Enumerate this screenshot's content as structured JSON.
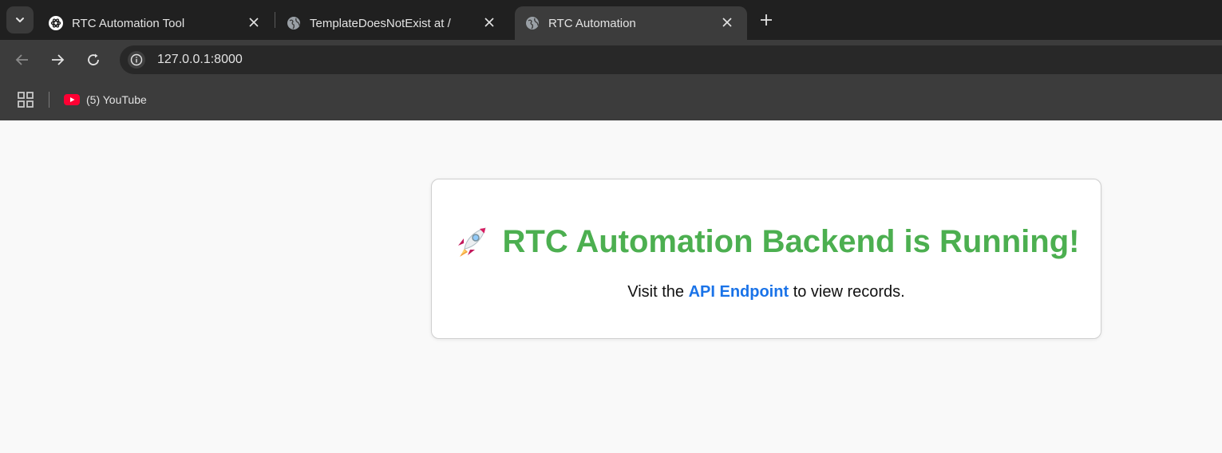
{
  "browser": {
    "tabs": [
      {
        "title": "RTC Automation Tool",
        "favicon": "openai-icon",
        "active": false
      },
      {
        "title": "TemplateDoesNotExist at /",
        "favicon": "globe-icon",
        "active": false
      },
      {
        "title": "RTC Automation",
        "favicon": "globe-icon",
        "active": true
      }
    ],
    "address_bar": {
      "url": "127.0.0.1:8000"
    },
    "bookmarks": [
      {
        "label": "(5) YouTube",
        "icon": "youtube-icon"
      }
    ],
    "accent": "#3c3c3c"
  },
  "page": {
    "headline": "RTC Automation Backend is Running!",
    "headline_icon": "rocket-icon",
    "headline_color": "#4caf50",
    "sub_prefix": "Visit the",
    "sub_link": "API Endpoint",
    "sub_suffix": "to view records.",
    "link_color": "#1a73e8"
  }
}
